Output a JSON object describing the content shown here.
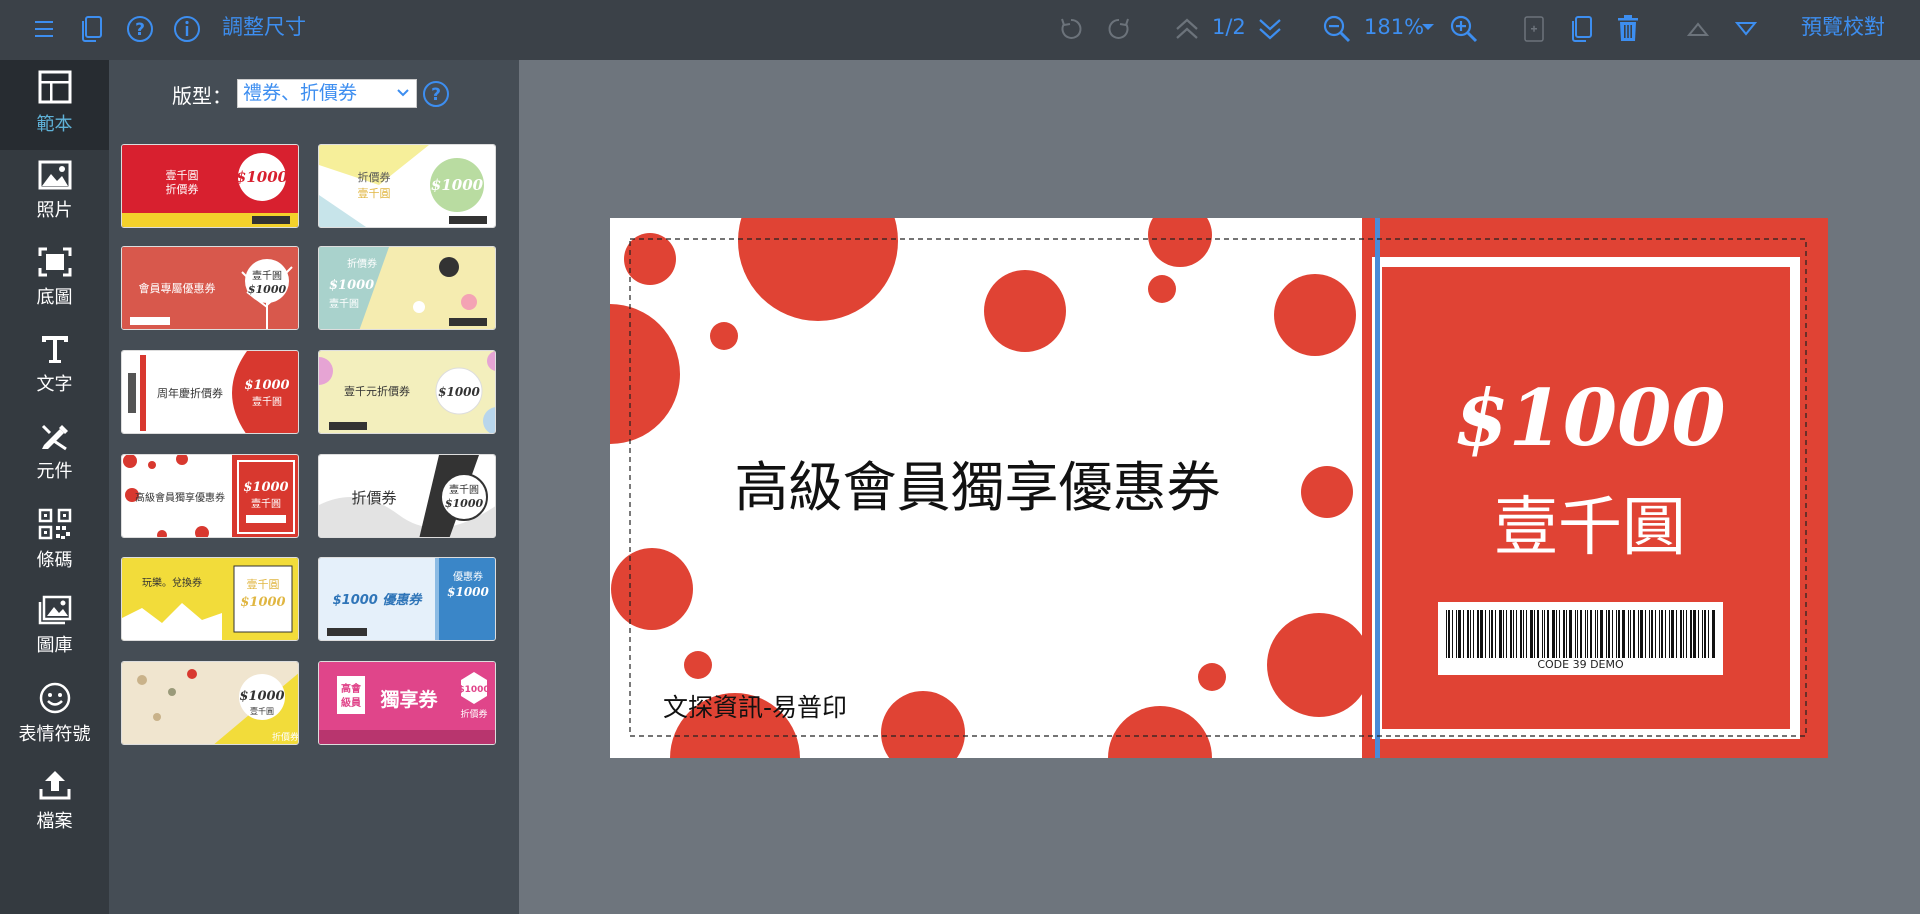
{
  "toolbar": {
    "resize_label": "調整尺寸",
    "page_indicator": "1/2",
    "zoom_level": "181%",
    "preview_label": "預覽校對",
    "accent_color": "#3d8ef0"
  },
  "sidebar": {
    "items": [
      {
        "label": "範本",
        "icon": "template-icon",
        "active": true
      },
      {
        "label": "照片",
        "icon": "photo-icon"
      },
      {
        "label": "底圖",
        "icon": "background-icon"
      },
      {
        "label": "文字",
        "icon": "text-icon"
      },
      {
        "label": "元件",
        "icon": "component-icon"
      },
      {
        "label": "條碼",
        "icon": "qrcode-icon"
      },
      {
        "label": "圖庫",
        "icon": "gallery-icon"
      },
      {
        "label": "表情符號",
        "icon": "emoji-icon"
      },
      {
        "label": "檔案",
        "icon": "upload-icon"
      }
    ]
  },
  "template_panel": {
    "type_label": "版型：",
    "type_value": "禮券、折價券",
    "thumbnails": [
      {
        "title": "壹千圓 折價券",
        "amount": "$1000"
      },
      {
        "title": "折價券 壹千圓",
        "amount": "$1000"
      },
      {
        "title": "會員專屬優惠券",
        "amount": "壹千圓 $1000"
      },
      {
        "title": "折價券 $1000 壹千圓",
        "amount": ""
      },
      {
        "title": "周年慶折價券",
        "amount": "$1000 壹千圓"
      },
      {
        "title": "壹千元折價券",
        "amount": "$1000"
      },
      {
        "title": "高級會員獨享優惠券",
        "amount": "$1000 壹千圓"
      },
      {
        "title": "折價券",
        "amount": "壹千圓 $1000"
      },
      {
        "title": "玩樂。兌換券",
        "amount": "壹千圓 $1000"
      },
      {
        "title": "$1000 優惠券",
        "amount": "優惠券 $1000"
      },
      {
        "title": "$1000 壹千圓",
        "amount": "折價券"
      },
      {
        "title": "高會 級員 獨享券",
        "amount": "$1000 折價券"
      }
    ]
  },
  "coupon": {
    "title": "高級會員獨享優惠券",
    "amount": "$1000",
    "amount_text": "壹千圓",
    "barcode_label": "CODE 39 DEMO",
    "company": "文探資訊-易普印",
    "red_color": "#e04334"
  }
}
